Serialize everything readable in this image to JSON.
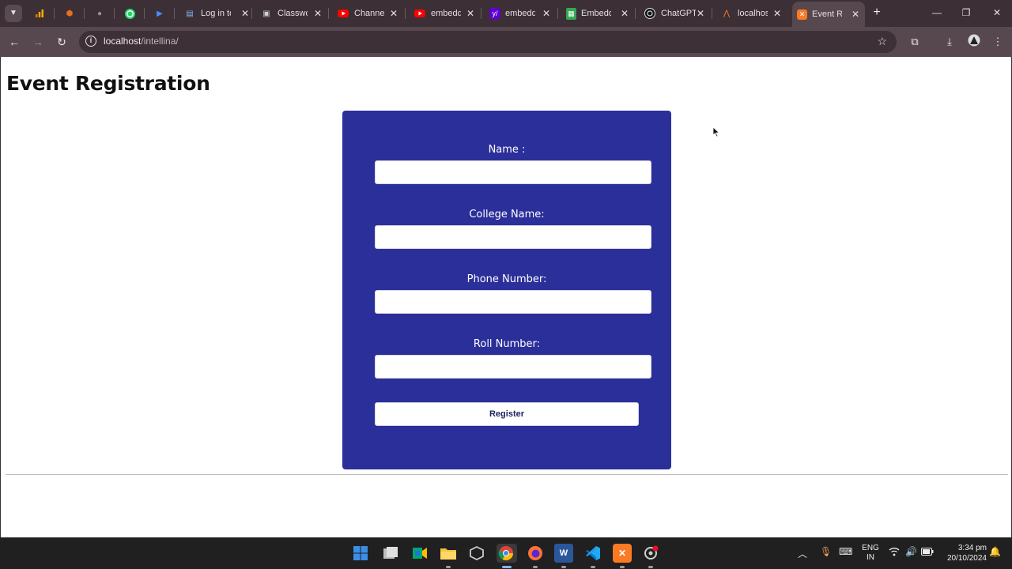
{
  "browser": {
    "tabs": [
      {
        "title": "",
        "favicon": "analytics-icon",
        "color": "#f9ab00"
      },
      {
        "title": "",
        "favicon": "shield-icon",
        "color": "#e8711a"
      },
      {
        "title": "",
        "favicon": "apple-icon",
        "color": "#9a8d93"
      },
      {
        "title": "",
        "favicon": "whatsapp-icon",
        "color": "#25d366"
      },
      {
        "title": "",
        "favicon": "play-icon",
        "color": "#4a8cff"
      },
      {
        "title": "Log in to",
        "favicon": "doc-icon",
        "color": "#8ab4f8"
      },
      {
        "title": "Classwork",
        "favicon": "classroom-icon",
        "color": "#cfcfcf"
      },
      {
        "title": "Channel",
        "favicon": "youtube-icon",
        "color": "#ff0000"
      },
      {
        "title": "embedd",
        "favicon": "youtube-icon",
        "color": "#ff0000"
      },
      {
        "title": "embedd",
        "favicon": "yahoo-icon",
        "color": "#6001d2"
      },
      {
        "title": "Embedd",
        "favicon": "sheets-icon",
        "color": "#34a853"
      },
      {
        "title": "ChatGPT",
        "favicon": "chatgpt-icon",
        "color": "#ffffff"
      },
      {
        "title": "localhost",
        "favicon": "xampp-icon",
        "color": "#fb7a24"
      },
      {
        "title": "Event Re",
        "favicon": "xampp-icon",
        "color": "#fb7a24"
      }
    ],
    "url_host": "localhost",
    "url_path": "/intellina/"
  },
  "page": {
    "title": "Event Registration",
    "form": {
      "fields": [
        {
          "label": "Name :",
          "value": ""
        },
        {
          "label": "College Name:",
          "value": ""
        },
        {
          "label": "Phone Number:",
          "value": ""
        },
        {
          "label": "Roll Number:",
          "value": ""
        }
      ],
      "submit_label": "Register"
    },
    "colors": {
      "card_background": "#2b2f9a",
      "page_background": "#ffffff"
    }
  },
  "taskbar": {
    "apps": [
      {
        "name": "windows-start-icon",
        "color": "#3a8ee6"
      },
      {
        "name": "task-view-icon",
        "color": "#cfcfcf"
      },
      {
        "name": "meet-icon",
        "color": "#00a86b"
      },
      {
        "name": "file-explorer-icon",
        "color": "#f4c542"
      },
      {
        "name": "unity-icon",
        "color": "#cccccc"
      },
      {
        "name": "chrome-icon",
        "color": "#4285f4"
      },
      {
        "name": "firefox-icon",
        "color": "#ff7139"
      },
      {
        "name": "word-icon",
        "color": "#2b579a"
      },
      {
        "name": "vscode-icon",
        "color": "#23a9f2"
      },
      {
        "name": "xampp-icon",
        "color": "#fb7a24"
      },
      {
        "name": "settings-icon",
        "color": "#cfcfcf"
      }
    ],
    "language_top": "ENG",
    "language_bottom": "IN",
    "time": "3:34 pm",
    "date": "20/10/2024"
  }
}
